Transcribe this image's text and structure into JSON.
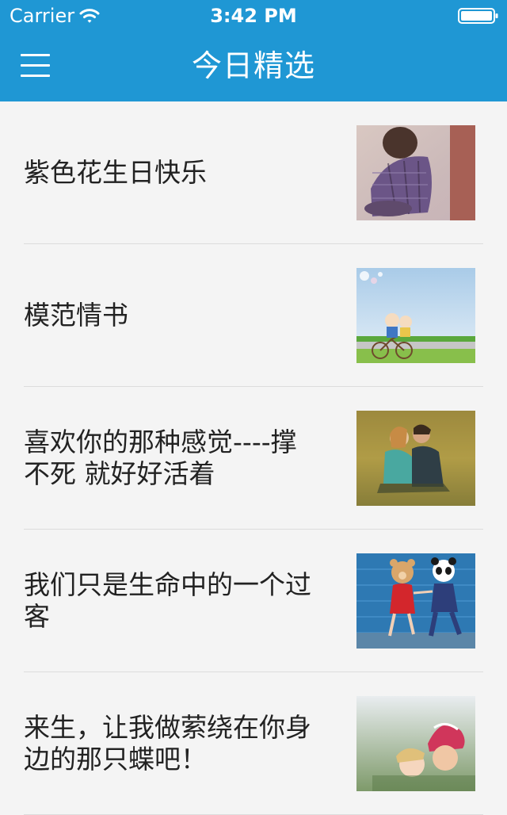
{
  "status_bar": {
    "carrier": "Carrier",
    "time": "3:42 PM",
    "wifi_icon": "wifi-icon",
    "battery_icon": "battery-icon"
  },
  "nav_bar": {
    "title": "今日精选",
    "menu_icon": "hamburger-menu-icon",
    "background_color": "#1f97d4"
  },
  "articles": [
    {
      "title": "紫色花生日快乐",
      "thumbnail": "couple-sitting-photo"
    },
    {
      "title": "模范情书",
      "thumbnail": "cartoon-bicycle-couple-photo"
    },
    {
      "title": "喜欢你的那种感觉----撑不死 就好好活着",
      "thumbnail": "couple-kissing-on-grass-photo"
    },
    {
      "title": "我们只是生命中的一个过客",
      "thumbnail": "bear-and-panda-mascots-photo"
    },
    {
      "title": "来生，让我做萦绕在你身边的那只蝶吧！",
      "thumbnail": "kids-kissing-photo"
    }
  ]
}
